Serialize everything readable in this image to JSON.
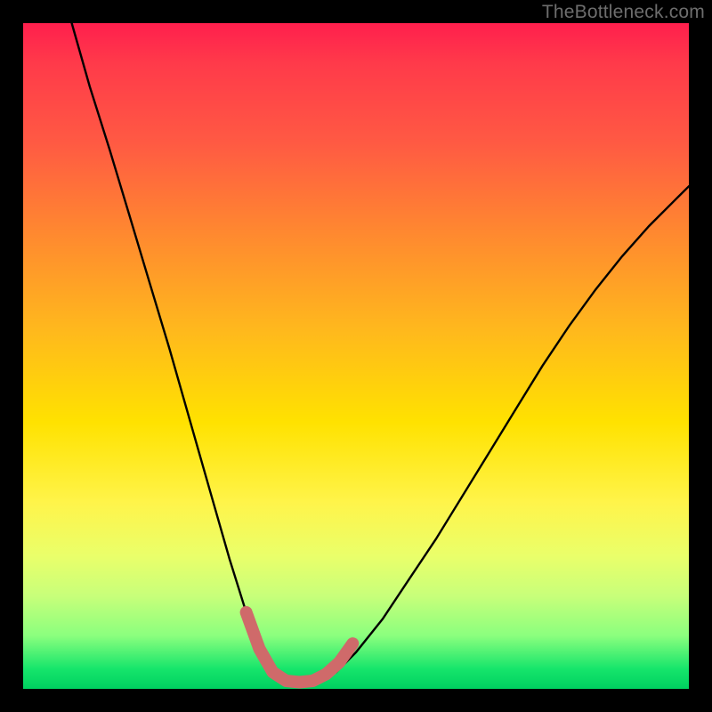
{
  "watermark": "TheBottleneck.com",
  "chart_data": {
    "type": "line",
    "title": "",
    "xlabel": "",
    "ylabel": "",
    "xlim": [
      0,
      1
    ],
    "ylim": [
      0,
      1
    ],
    "grid": false,
    "series": [
      {
        "name": "bottleneck-curve",
        "stroke": "#000000",
        "stroke_width": 2.4,
        "x": [
          0.073,
          0.1,
          0.13,
          0.16,
          0.19,
          0.22,
          0.25,
          0.28,
          0.31,
          0.335,
          0.355,
          0.375,
          0.4,
          0.43,
          0.47,
          0.5,
          0.54,
          0.58,
          0.62,
          0.66,
          0.7,
          0.74,
          0.78,
          0.82,
          0.86,
          0.9,
          0.94,
          0.98,
          1.0
        ],
        "y": [
          1.0,
          0.905,
          0.81,
          0.71,
          0.61,
          0.51,
          0.405,
          0.3,
          0.195,
          0.115,
          0.06,
          0.025,
          0.01,
          0.01,
          0.025,
          0.055,
          0.105,
          0.165,
          0.225,
          0.29,
          0.355,
          0.42,
          0.485,
          0.545,
          0.6,
          0.65,
          0.695,
          0.735,
          0.755
        ]
      },
      {
        "name": "valley-highlight",
        "stroke": "#cf6a6a",
        "stroke_width": 14,
        "linecap": "round",
        "x": [
          0.335,
          0.355,
          0.375,
          0.395,
          0.415,
          0.435,
          0.455,
          0.475,
          0.495
        ],
        "y": [
          0.115,
          0.06,
          0.025,
          0.012,
          0.01,
          0.012,
          0.022,
          0.04,
          0.068
        ]
      }
    ]
  }
}
